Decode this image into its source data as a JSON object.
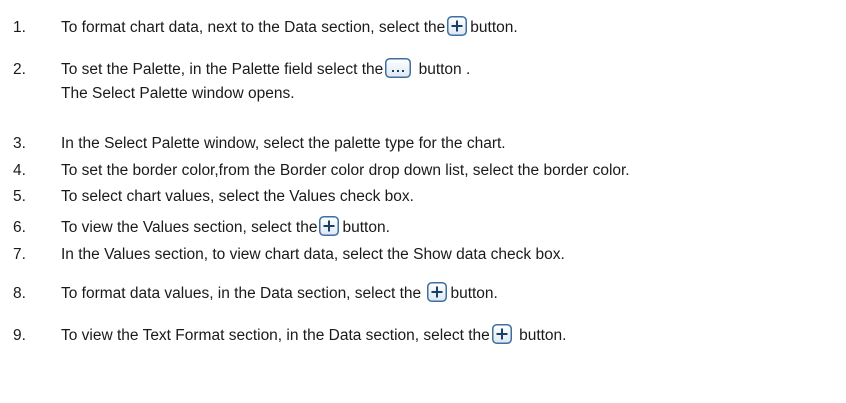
{
  "steps": [
    {
      "number": "1.",
      "before": "To format chart data, next to the Data section, select the",
      "icon": "plus-icon",
      "after": "button."
    },
    {
      "number": "2.",
      "before": "To set the Palette, in the Palette field select the",
      "icon": "ellipsis-icon",
      "after": " button .",
      "continuation": "The Select Palette window opens."
    },
    {
      "number": "3.",
      "text": "In the Select Palette window, select the palette type for the chart."
    },
    {
      "number": "4.",
      "text": "To set the border color,from the Border color drop down list, select the border color."
    },
    {
      "number": "5.",
      "text": "To select  chart values, select the Values check box."
    },
    {
      "number": "6.",
      "before": "To view the Values section, select the",
      "icon": "plus-icon",
      "after": "button."
    },
    {
      "number": "7.",
      "text": "In the Values section, to view chart data, select the Show data check box."
    },
    {
      "number": "8.",
      "before": "To format data values, in the Data section, select the ",
      "icon": "plus-icon",
      "after": "button."
    },
    {
      "number": "9.",
      "before": "To view the Text Format section, in the Data section, select the",
      "icon": "plus-icon",
      "after": " button."
    }
  ],
  "colors": {
    "icon_border": "#3f6f9f",
    "icon_fill_top": "#ffffff",
    "icon_fill_bottom": "#dde8f3",
    "icon_glyph": "#1a3f66"
  }
}
